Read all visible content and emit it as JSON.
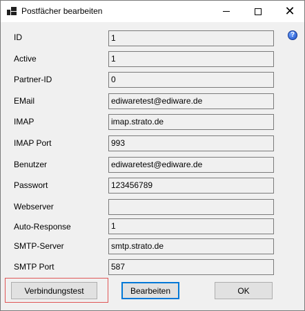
{
  "window": {
    "title": "Postfächer bearbeiten"
  },
  "fields": [
    {
      "label": "ID",
      "value": "1"
    },
    {
      "label": "Active",
      "value": "1"
    },
    {
      "label": "Partner-ID",
      "value": "0"
    },
    {
      "label": "EMail",
      "value": "ediwaretest@ediware.de"
    },
    {
      "label": "IMAP",
      "value": "imap.strato.de"
    },
    {
      "label": "IMAP Port",
      "value": "993"
    },
    {
      "label": "Benutzer",
      "value": "ediwaretest@ediware.de"
    },
    {
      "label": "Passwort",
      "value": "123456789"
    },
    {
      "label": "Webserver",
      "value": ""
    },
    {
      "label": "Auto-Response",
      "value": "1"
    },
    {
      "label": "SMTP-Server",
      "value": "smtp.strato.de"
    },
    {
      "label": "SMTP Port",
      "value": "587"
    }
  ],
  "buttons": {
    "test": "Verbindungstest",
    "edit": "Bearbeiten",
    "ok": "OK"
  },
  "help": "?",
  "close_glyph": "✕"
}
